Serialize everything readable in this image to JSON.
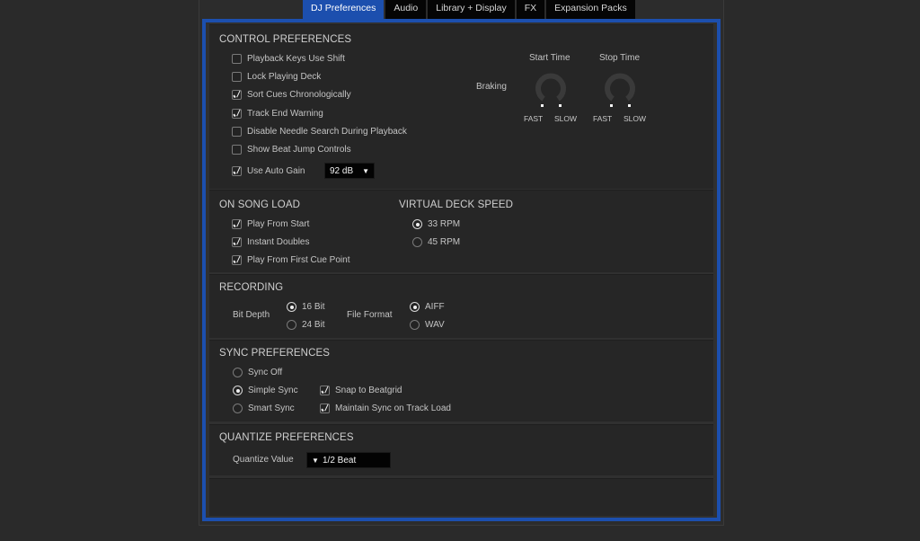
{
  "tabs": [
    {
      "label": "DJ Preferences",
      "active": true
    },
    {
      "label": "Audio",
      "active": false
    },
    {
      "label": "Library + Display",
      "active": false
    },
    {
      "label": "FX",
      "active": false
    },
    {
      "label": "Expansion Packs",
      "active": false
    }
  ],
  "control_preferences": {
    "title": "CONTROL PREFERENCES",
    "options": [
      {
        "label": "Playback Keys Use Shift",
        "checked": false
      },
      {
        "label": "Lock Playing Deck",
        "checked": false
      },
      {
        "label": "Sort Cues Chronologically",
        "checked": true
      },
      {
        "label": "Track End Warning",
        "checked": true
      },
      {
        "label": "Disable Needle Search During Playback",
        "checked": false
      },
      {
        "label": "Show Beat Jump Controls",
        "checked": false
      },
      {
        "label": "Use Auto Gain",
        "checked": true
      }
    ],
    "auto_gain_value": "92 dB",
    "braking": {
      "label": "Braking",
      "start_time_label": "Start Time",
      "stop_time_label": "Stop Time",
      "fast_label": "FAST",
      "slow_label": "SLOW"
    }
  },
  "on_song_load": {
    "title": "ON SONG LOAD",
    "options": [
      {
        "label": "Play From Start",
        "checked": true
      },
      {
        "label": "Instant Doubles",
        "checked": true
      },
      {
        "label": "Play From First Cue Point",
        "checked": true
      }
    ]
  },
  "virtual_deck_speed": {
    "title": "VIRTUAL DECK SPEED",
    "options": [
      {
        "label": "33 RPM",
        "selected": true
      },
      {
        "label": "45 RPM",
        "selected": false
      }
    ]
  },
  "recording": {
    "title": "RECORDING",
    "bit_depth_label": "Bit Depth",
    "bit_depth_options": [
      {
        "label": "16 Bit",
        "selected": true
      },
      {
        "label": "24 Bit",
        "selected": false
      }
    ],
    "file_format_label": "File Format",
    "file_format_options": [
      {
        "label": "AIFF",
        "selected": true
      },
      {
        "label": "WAV",
        "selected": false
      }
    ]
  },
  "sync_preferences": {
    "title": "SYNC PREFERENCES",
    "modes": [
      {
        "label": "Sync Off",
        "selected": false
      },
      {
        "label": "Simple Sync",
        "selected": true
      },
      {
        "label": "Smart Sync",
        "selected": false
      }
    ],
    "options": [
      {
        "label": "Snap to Beatgrid",
        "checked": true
      },
      {
        "label": "Maintain Sync on Track Load",
        "checked": true
      }
    ]
  },
  "quantize_preferences": {
    "title": "QUANTIZE PREFERENCES",
    "value_label": "Quantize Value",
    "value": "1/2 Beat",
    "arrow": "▼"
  },
  "icons": {
    "dropdown_arrow": "▼"
  }
}
